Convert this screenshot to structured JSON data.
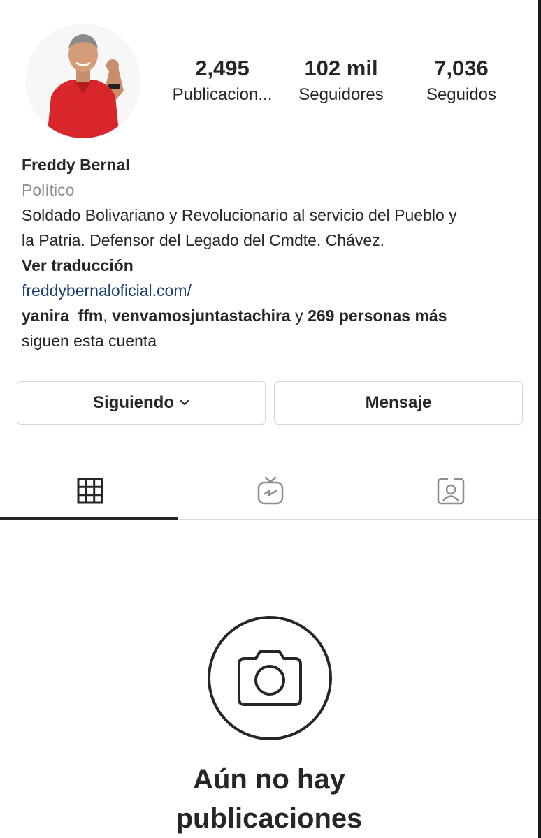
{
  "profile": {
    "stats": {
      "posts": {
        "value": "2,495",
        "label": "Publicacion..."
      },
      "followers": {
        "value": "102 mil",
        "label": "Seguidores"
      },
      "following": {
        "value": "7,036",
        "label": "Seguidos"
      }
    },
    "name": "Freddy Bernal",
    "category": "Político",
    "bio": "Soldado Bolivariano y Revolucionario al servicio del Pueblo y\nla Patria. Defensor del Legado del Cmdte. Chávez.",
    "translate_label": "Ver traducción",
    "website": "freddybernaloficial.com/",
    "followed_by": {
      "user1": "yanira_ffm",
      "separator": ", ",
      "user2": "venvamosjuntastachira",
      "conjunction": " y ",
      "others": "269 personas más",
      "suffix": "siguen esta cuenta"
    }
  },
  "actions": {
    "following_label": "Siguiendo",
    "message_label": "Mensaje"
  },
  "tabs": [
    {
      "icon": "grid-icon",
      "active": true
    },
    {
      "icon": "igtv-icon",
      "active": false
    },
    {
      "icon": "tagged-icon",
      "active": false
    }
  ],
  "empty_state": {
    "icon": "camera-icon",
    "title": "Aún no hay\npublicaciones"
  },
  "colors": {
    "text": "#262626",
    "secondary": "#8e8e8e",
    "link": "#1c3f6e",
    "border": "#dbdbdb",
    "shirt": "#d8262a"
  }
}
